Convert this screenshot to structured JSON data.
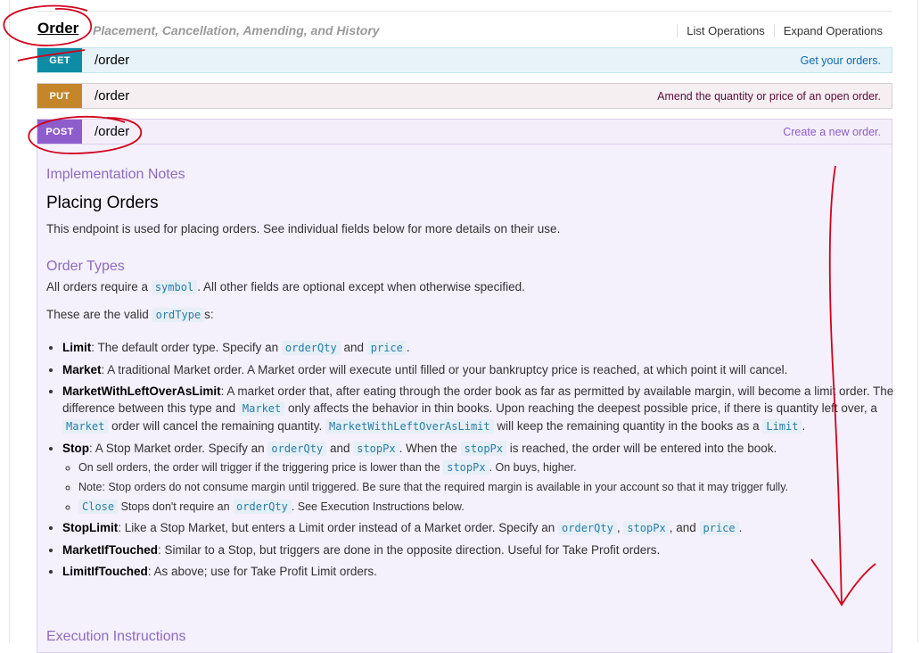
{
  "resource": {
    "name": "Order",
    "description": "Placement, Cancellation, Amending, and History",
    "ops_links": [
      "List Operations",
      "Expand Operations"
    ]
  },
  "operations": [
    {
      "method": "GET",
      "path": "/order",
      "summary": "Get your orders."
    },
    {
      "method": "PUT",
      "path": "/order",
      "summary": "Amend the quantity or price of an open order."
    },
    {
      "method": "POST",
      "path": "/order",
      "summary": "Create a new order."
    }
  ],
  "content": {
    "impl_heading": "Implementation Notes",
    "title": "Placing Orders",
    "intro": "This endpoint is used for placing orders. See individual fields below for more details on their use.",
    "order_types_heading": "Order Types",
    "req_pre": "All orders require a",
    "req_code": "symbol",
    "req_post": ". All other fields are optional except when otherwise specified.",
    "valid_pre": "These are the valid",
    "valid_code": "ordType",
    "valid_post": "s:",
    "limit": {
      "name": "Limit",
      "t1": ": The default order type. Specify an",
      "c1": "orderQty",
      "t2": "and",
      "c2": "price",
      "t3": "."
    },
    "market": {
      "name": "Market",
      "text": ": A traditional Market order. A Market order will execute until filled or your bankruptcy price is reached, at which point it will cancel."
    },
    "mwloal": {
      "name": "MarketWithLeftOverAsLimit",
      "t1": ": A market order that, after eating through the order book as far as permitted by available margin, will become a limit order. The difference between this type and",
      "c1": "Market",
      "t2": "only affects the behavior in thin books. Upon reaching the deepest possible price, if there is quantity left over, a",
      "c2": "Market",
      "t3": "order will cancel the remaining quantity.",
      "c3": "MarketWithLeftOverAsLimit",
      "t4": "will keep the remaining quantity in the books as a",
      "c4": "Limit",
      "t5": "."
    },
    "stop": {
      "name": "Stop",
      "t1": ": A Stop Market order. Specify an",
      "c1": "orderQty",
      "t2": "and",
      "c2": "stopPx",
      "t3": ". When the",
      "c3": "stopPx",
      "t4": "is reached, the order will be entered into the book.",
      "sub1_pre": "On sell orders, the order will trigger if the triggering price is lower than the",
      "sub1_code": "stopPx",
      "sub1_post": ". On buys, higher.",
      "sub2": "Note: Stop orders do not consume margin until triggered. Be sure that the required margin is available in your account so that it may trigger fully.",
      "sub3_code1": "Close",
      "sub3_mid": "Stops don't require an",
      "sub3_code2": "orderQty",
      "sub3_post": ". See Execution Instructions below."
    },
    "stoplimit": {
      "name": "StopLimit",
      "t1": ": Like a Stop Market, but enters a Limit order instead of a Market order. Specify an",
      "c1": "orderQty",
      "t2": ",",
      "c2": "stopPx",
      "t3": ", and",
      "c3": "price",
      "t4": "."
    },
    "mit": {
      "name": "MarketIfTouched",
      "text": ": Similar to a Stop, but triggers are done in the opposite direction. Useful for Take Profit orders."
    },
    "lit": {
      "name": "LimitIfTouched",
      "text": ": As above; use for Take Profit Limit orders."
    },
    "exec_heading": "Execution Instructions"
  },
  "colors": {
    "get": "#0f8ca5",
    "put": "#c5862b",
    "post": "#8e5dcc",
    "annotation": "#d0021b"
  }
}
